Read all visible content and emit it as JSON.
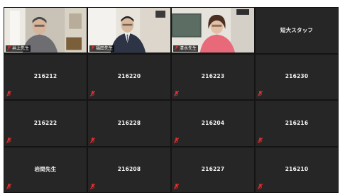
{
  "participants": [
    {
      "name": "井上先生",
      "video": true
    },
    {
      "name": "福田先生",
      "video": true
    },
    {
      "name": "清水先生",
      "video": true
    },
    {
      "name": "短大スタッフ",
      "video": false
    },
    {
      "name": "216212",
      "video": false
    },
    {
      "name": "216220",
      "video": false
    },
    {
      "name": "216223",
      "video": false
    },
    {
      "name": "216230",
      "video": false
    },
    {
      "name": "216222",
      "video": false
    },
    {
      "name": "216228",
      "video": false
    },
    {
      "name": "216204",
      "video": false
    },
    {
      "name": "216216",
      "video": false
    },
    {
      "name": "岩間先生",
      "video": false
    },
    {
      "name": "216208",
      "video": false
    },
    {
      "name": "216227",
      "video": false
    },
    {
      "name": "216210",
      "video": false
    }
  ],
  "colors": {
    "muted_mic": "#e03030",
    "tile_bg": "#262626",
    "grid_bg": "#141414"
  },
  "icons": {
    "mic_state": "muted-mic-icon"
  }
}
